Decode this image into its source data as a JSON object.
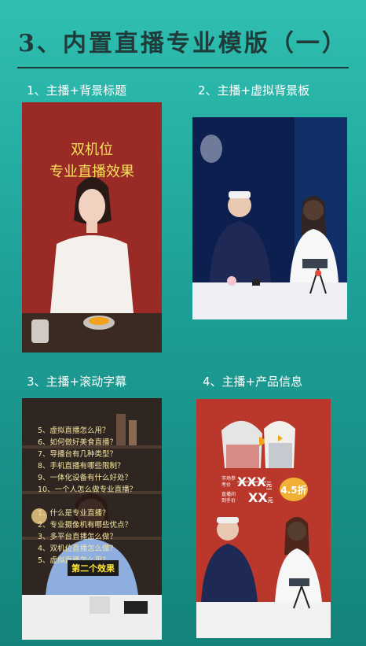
{
  "title": "3、内置直播专业模版（一）",
  "panels": [
    {
      "caption": "1、主播+背景标题",
      "headline_1": "双机位",
      "headline_2": "专业直播效果"
    },
    {
      "caption": "2、主播+虚拟背景板"
    },
    {
      "caption": "3、主播+滚动字幕",
      "scroll_lines": [
        "5、虚拟直播怎么用？",
        "6、如何做好美食直播？",
        "7、导播台有几种类型？",
        "8、手机直播有哪些限制？",
        "9、一体化设备有什么好处？",
        "10、一个人怎么做专业直播？",
        "",
        "1、什么是专业直播？",
        "2、专业摄像机有哪些优点？",
        "3、多平台直播怎么做？",
        "4、双机位直播怎么做？",
        "5、虚拟直播怎么用？"
      ],
      "subtitle": "第二个效果"
    },
    {
      "caption": "4、主播+产品信息",
      "market_price_label": "市场参考价",
      "market_price": "XXX",
      "market_price_unit": "元",
      "live_price_label": "直播间到手价",
      "live_price": "XX",
      "live_price_unit": "元",
      "discount": "4.5折"
    }
  ],
  "colors": {
    "accent_text": "#f6e05a",
    "panel1_bg": "#9a2a26",
    "panel4_bg": "#b9372b",
    "badge": "#f0b035"
  }
}
